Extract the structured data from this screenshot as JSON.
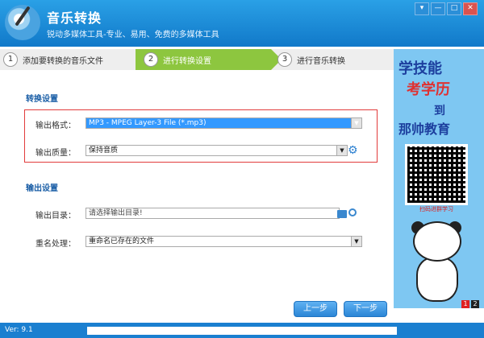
{
  "app": {
    "title": "音乐转换",
    "subtitle": "锐动多媒体工具-专业、易用、免费的多媒体工具",
    "version": "Ver: 9.1"
  },
  "window_buttons": [
    "▾",
    "—",
    "□",
    "✕"
  ],
  "steps": [
    {
      "num": "1",
      "label": "添加要转换的音乐文件",
      "active": false
    },
    {
      "num": "2",
      "label": "进行转换设置",
      "active": true
    },
    {
      "num": "3",
      "label": "进行音乐转换",
      "active": false
    }
  ],
  "convert_settings": {
    "title": "转换设置",
    "format_label": "输出格式：",
    "format_value": "MP3 - MPEG Layer-3 File (*.mp3)",
    "quality_label": "输出质量：",
    "quality_value": "保持音质"
  },
  "output_settings": {
    "title": "输出设置",
    "dir_label": "输出目录：",
    "dir_placeholder": "请选择输出目录!",
    "rename_label": "重名处理：",
    "rename_value": "重命名已存在的文件"
  },
  "buttons": {
    "prev": "上一步",
    "next": "下一步"
  },
  "ad": {
    "line1": "学技能",
    "line2": "考学历",
    "line3": "到",
    "line4": "那帅教育",
    "qr_caption": "扫码进群学习",
    "pages": [
      "1",
      "2"
    ],
    "active_page": "1"
  },
  "progress": {
    "fraction": 0
  },
  "colors": {
    "accent": "#1a7fd0",
    "active_step": "#8dc63f",
    "highlight": "#e23b3b"
  }
}
